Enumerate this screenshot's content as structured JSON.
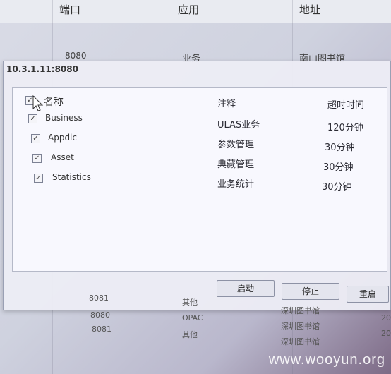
{
  "background": {
    "header": [
      "端口",
      "应用",
      "地址"
    ],
    "row1": {
      "port": "8080",
      "app": "业务",
      "address": "南山图书馆"
    },
    "bottom_rows": [
      {
        "port": "8081",
        "app": "其他",
        "address": "深圳图书馆",
        "extra": ""
      },
      {
        "port": "8080",
        "app": "OPAC",
        "address": "深圳图书馆",
        "extra": "20"
      },
      {
        "port": "8081",
        "app": "其他",
        "address": "深圳图书馆",
        "extra": "20"
      }
    ]
  },
  "dialog": {
    "title": "10.3.1.11:8080",
    "tree": {
      "root": "名称",
      "items": [
        "Business",
        "Appdic",
        "Asset",
        "Statistics"
      ]
    },
    "table": {
      "headers": {
        "note": "注释",
        "timeout": "超时时间"
      },
      "rows": [
        {
          "note": "ULAS业务",
          "timeout": "120分钟"
        },
        {
          "note": "参数管理",
          "timeout": "30分钟"
        },
        {
          "note": "典藏管理",
          "timeout": "30分钟"
        },
        {
          "note": "业务统计",
          "timeout": "30分钟"
        }
      ]
    },
    "buttons": {
      "start": "启动",
      "stop": "停止",
      "restart": "重启"
    }
  },
  "watermark": "www.wooyun.org",
  "checkmark": "✓"
}
